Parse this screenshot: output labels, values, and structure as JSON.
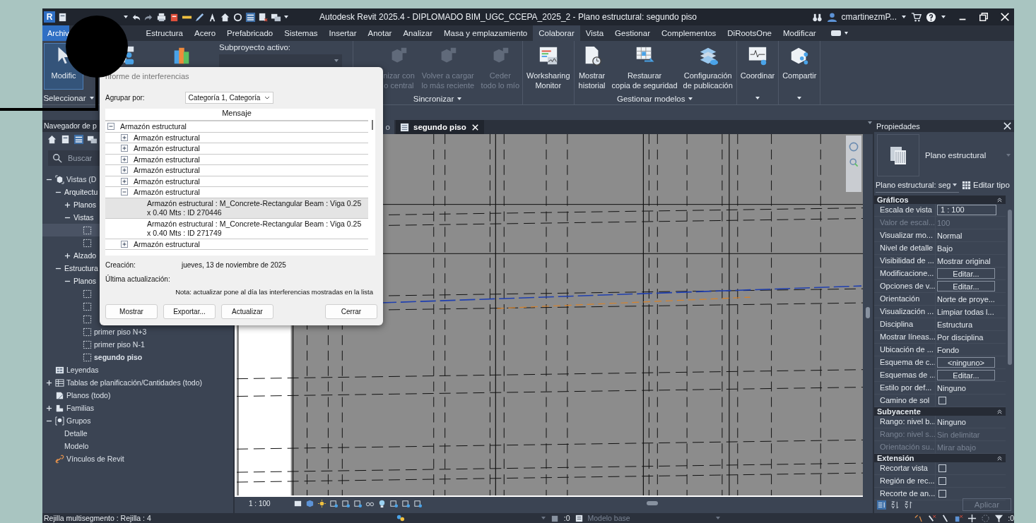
{
  "window": {
    "logo": "R",
    "title": "Autodesk Revit 2025.4 - DIPLOMADO BIM_UGC_CCEPA_2025_2 - Plano estructural: segundo piso",
    "user": "cmartinezmP..."
  },
  "ribbon_tabs": [
    {
      "label": "Archiv",
      "kind": "file",
      "selected": false
    },
    {
      "label": "Estructura",
      "kind": "tab",
      "selected": false
    },
    {
      "label": "Acero",
      "kind": "tab",
      "selected": false
    },
    {
      "label": "Prefabricado",
      "kind": "tab",
      "selected": false
    },
    {
      "label": "Sistemas",
      "kind": "tab",
      "selected": false
    },
    {
      "label": "Insertar",
      "kind": "tab",
      "selected": false
    },
    {
      "label": "Anotar",
      "kind": "tab",
      "selected": false
    },
    {
      "label": "Analizar",
      "kind": "tab",
      "selected": false
    },
    {
      "label": "Masa y emplazamiento",
      "kind": "tab",
      "selected": false
    },
    {
      "label": "Colaborar",
      "kind": "tab",
      "selected": true
    },
    {
      "label": "Vista",
      "kind": "tab",
      "selected": false
    },
    {
      "label": "Gestionar",
      "kind": "tab",
      "selected": false
    },
    {
      "label": "Complementos",
      "kind": "tab",
      "selected": false
    },
    {
      "label": "DiRootsOne",
      "kind": "tab",
      "selected": false
    },
    {
      "label": "Modificar",
      "kind": "tab",
      "selected": false
    }
  ],
  "ribbon_panels": [
    {
      "label": "Seleccionar",
      "dropdown": true,
      "buttons": [
        {
          "lines": [
            "Modific"
          ],
          "selected": true,
          "disabled": false
        }
      ]
    },
    {
      "buttons": [
        {
          "selected": false,
          "disabled": false
        },
        {
          "selected": false,
          "disabled": false
        }
      ],
      "subproject_label": "Subproyecto activo:"
    },
    {
      "label": "Sincronizar",
      "dropdown": true,
      "buttons": [
        {
          "lines": [
            "nizar con",
            "o central"
          ],
          "selected": false,
          "disabled": true
        },
        {
          "lines": [
            "Volver a cargar",
            "lo más reciente"
          ],
          "selected": false,
          "disabled": true
        },
        {
          "lines": [
            "Ceder",
            "todo lo mío"
          ],
          "selected": false,
          "disabled": true
        }
      ]
    },
    {
      "dropdown": false,
      "buttons": [
        {
          "lines": [
            "Worksharing",
            "Monitor"
          ],
          "selected": false,
          "disabled": false
        }
      ]
    },
    {
      "label": "Gestionar modelos",
      "dropdown": true,
      "buttons": [
        {
          "lines": [
            "Mostrar",
            "historial"
          ],
          "selected": false,
          "disabled": false
        },
        {
          "lines": [
            "Restaurar",
            "copia de seguridad"
          ],
          "selected": false,
          "disabled": false
        },
        {
          "lines": [
            "Configuración",
            "de publicación"
          ],
          "selected": false,
          "disabled": false
        }
      ]
    },
    {
      "dropdown": true,
      "buttons": [
        {
          "lines": [
            "Coordinar"
          ],
          "selected": false,
          "disabled": false
        }
      ]
    },
    {
      "dropdown": true,
      "buttons": [
        {
          "lines": [
            "Compartir"
          ],
          "selected": false,
          "disabled": false
        }
      ]
    }
  ],
  "project_browser": {
    "title": "Navegador de p",
    "search": {
      "placeholder": "Buscar"
    },
    "tree": [
      {
        "label": "Vistas (D",
        "kind": "views",
        "expanded": true,
        "children": [
          {
            "label": "Arquitectu",
            "kind": "folder",
            "expanded": true,
            "children": [
              {
                "label": "Planos",
                "kind": "folder",
                "expanded": false
              },
              {
                "label": "Vistas",
                "kind": "folder",
                "expanded": true,
                "children": [
                  {
                    "kind": "view",
                    "selected": true
                  },
                  {
                    "kind": "view",
                    "selected": false
                  }
                ]
              },
              {
                "label": "Alzado",
                "kind": "folder",
                "expanded": false
              }
            ]
          },
          {
            "label": "Estructura",
            "kind": "folder",
            "expanded": true,
            "children": [
              {
                "label": "Planos",
                "kind": "folder",
                "expanded": true,
                "children": [
                  {
                    "kind": "view",
                    "selected": false
                  },
                  {
                    "kind": "view",
                    "selected": false
                  },
                  {
                    "kind": "view",
                    "selected": false
                  },
                  {
                    "label": "primer piso N+3",
                    "kind": "view",
                    "selected": false,
                    "current": false
                  },
                  {
                    "label": "primer piso N-1",
                    "kind": "view",
                    "selected": false,
                    "current": false
                  },
                  {
                    "label": "segundo piso",
                    "kind": "view",
                    "selected": false,
                    "current": true
                  }
                ]
              }
            ]
          }
        ]
      },
      {
        "label": "Leyendas",
        "kind": "legends"
      },
      {
        "label": "Tablas de planificación/Cantidades (todo)",
        "kind": "schedules",
        "expanded": false
      },
      {
        "label": "Planos (todo)",
        "kind": "sheets"
      },
      {
        "label": "Familias",
        "kind": "families",
        "expanded": false
      },
      {
        "label": "Grupos",
        "kind": "groups",
        "expanded": true,
        "children": [
          {
            "label": "Detalle"
          },
          {
            "label": "Modelo"
          }
        ]
      },
      {
        "label": "Vínculos de Revit",
        "kind": "links"
      }
    ]
  },
  "view_tabs": [
    {
      "label": "o",
      "selected": false
    },
    {
      "label": "segundo piso",
      "selected": true
    }
  ],
  "view_control_bar": {
    "scale": "1 : 100"
  },
  "properties": {
    "title": "Propiedades",
    "type_name": "Plano estructural",
    "instance_selector": "Plano estructural: seg",
    "edit_type": "Editar tipo",
    "apply": "Aplicar",
    "apply_disabled": true,
    "sections": [
      {
        "title": "Gráficos",
        "expanded": true,
        "rows": [
          {
            "label": "Escala de vista",
            "value": "1 : 100",
            "kind": "field",
            "disabled": false
          },
          {
            "label": "Valor de escal...",
            "value": "100",
            "kind": "text",
            "disabled": true
          },
          {
            "label": "Visualizar mo...",
            "value": "Normal",
            "kind": "text",
            "disabled": false
          },
          {
            "label": "Nivel de detalle",
            "value": "Bajo",
            "kind": "text",
            "disabled": false
          },
          {
            "label": "Visibilidad de ...",
            "value": "Mostrar original",
            "kind": "text",
            "disabled": false
          },
          {
            "label": "Modificacione...",
            "value": "Editar...",
            "kind": "button",
            "disabled": false
          },
          {
            "label": "Opciones de v...",
            "value": "Editar...",
            "kind": "button",
            "disabled": false
          },
          {
            "label": "Orientación",
            "value": "Norte de proye...",
            "kind": "text",
            "disabled": false
          },
          {
            "label": "Visualización ...",
            "value": "Limpiar todas l...",
            "kind": "text",
            "disabled": false
          },
          {
            "label": "Disciplina",
            "value": "Estructura",
            "kind": "text",
            "disabled": false
          },
          {
            "label": "Mostrar líneas...",
            "value": "Por disciplina",
            "kind": "text",
            "disabled": false
          },
          {
            "label": "Ubicación de ...",
            "value": "Fondo",
            "kind": "text",
            "disabled": false
          },
          {
            "label": "Esquema de c...",
            "value": "<ninguno>",
            "kind": "button",
            "disabled": false
          },
          {
            "label": "Esquemas de ...",
            "value": "Editar...",
            "kind": "button",
            "disabled": false
          },
          {
            "label": "Estilo por def...",
            "value": "Ninguno",
            "kind": "text",
            "disabled": false
          },
          {
            "label": "Camino de sol",
            "kind": "checkbox",
            "checked": false,
            "disabled": false
          }
        ]
      },
      {
        "title": "Subyacente",
        "expanded": true,
        "rows": [
          {
            "label": "Rango: nivel b...",
            "value": "Ninguno",
            "kind": "text",
            "disabled": false
          },
          {
            "label": "Rango: nivel s...",
            "value": "Sin delimitar",
            "kind": "text",
            "disabled": true
          },
          {
            "label": "Orientación su...",
            "value": "Mirar abajo",
            "kind": "text",
            "disabled": true
          }
        ]
      },
      {
        "title": "Extensión",
        "expanded": true,
        "rows": [
          {
            "label": "Recortar vista",
            "kind": "checkbox",
            "checked": false,
            "disabled": false
          },
          {
            "label": "Región de rec...",
            "kind": "checkbox",
            "checked": false,
            "disabled": false
          },
          {
            "label": "Recorte de an...",
            "kind": "checkbox",
            "checked": false,
            "disabled": false
          }
        ]
      }
    ]
  },
  "status_bar": {
    "selection": "Rejilla multisegmento : Rejilla : 4",
    "workset_count": ":0",
    "design_option": "Modelo base",
    "filter_count": ":0"
  },
  "dialog": {
    "title": "nforme de interferencias",
    "group_by_label": "Agrupar por:",
    "group_by_value": "Categoría 1, Categoría",
    "column": "Mensaje",
    "tree": [
      {
        "label": "Armazón estructural",
        "expanded": true,
        "children": [
          {
            "label": "Armazón estructural",
            "expanded": false
          },
          {
            "label": "Armazón estructural",
            "expanded": false
          },
          {
            "label": "Armazón estructural",
            "expanded": false
          },
          {
            "label": "Armazón estructural",
            "expanded": false
          },
          {
            "label": "Armazón estructural",
            "expanded": false
          },
          {
            "label": "Armazón estructural",
            "expanded": true,
            "children": [
              {
                "label": "Armazón estructural : M_Concrete-Rectangular Beam : Viga 0.25 x 0.40 Mts : ID 270446",
                "selected": true
              },
              {
                "label": "Armazón estructural : M_Concrete-Rectangular Beam : Viga 0.25 x 0.40 Mts : ID 271749",
                "selected": false
              }
            ]
          },
          {
            "label": "Armazón estructural",
            "expanded": false
          }
        ]
      }
    ],
    "created_label": "Creación:",
    "created_value": "jueves, 13 de noviembre de 2025",
    "updated_label": "Última actualización:",
    "note": "Nota: actualizar pone al día las interferencias mostradas en la lista",
    "buttons": [
      {
        "label": "Mostrar",
        "kind": "left"
      },
      {
        "label": "Exportar...",
        "kind": "left"
      },
      {
        "label": "Actualizar",
        "kind": "left"
      },
      {
        "label": "Cerrar",
        "kind": "right"
      }
    ]
  }
}
